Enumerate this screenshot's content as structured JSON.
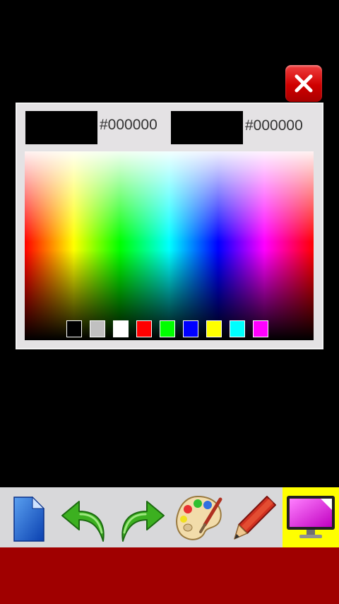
{
  "dialog": {
    "primary_color": {
      "swatch": "#000000",
      "hex_text": "#000000"
    },
    "secondary_color": {
      "swatch": "#000000",
      "hex_text": "#000000"
    },
    "presets": [
      {
        "name": "black",
        "color": "#000000"
      },
      {
        "name": "gray",
        "color": "#c0c0c0"
      },
      {
        "name": "white",
        "color": "#ffffff"
      },
      {
        "name": "red",
        "color": "#ff0000"
      },
      {
        "name": "green",
        "color": "#00ff00"
      },
      {
        "name": "blue",
        "color": "#0000ff"
      },
      {
        "name": "yellow",
        "color": "#ffff00"
      },
      {
        "name": "cyan",
        "color": "#00ffff"
      },
      {
        "name": "magenta",
        "color": "#ff00ff"
      }
    ]
  },
  "toolbar": {
    "tools": [
      {
        "name": "new-page-icon"
      },
      {
        "name": "undo-arrow-icon"
      },
      {
        "name": "redo-arrow-icon"
      },
      {
        "name": "palette-icon"
      },
      {
        "name": "pencil-icon"
      },
      {
        "name": "display-color-icon",
        "active": true
      }
    ]
  },
  "colors": {
    "close_button": "#d00000",
    "toolbar_background": "#d8d8da",
    "active_tool_highlight": "#ffff00",
    "bottom_bar": "#a00000"
  }
}
